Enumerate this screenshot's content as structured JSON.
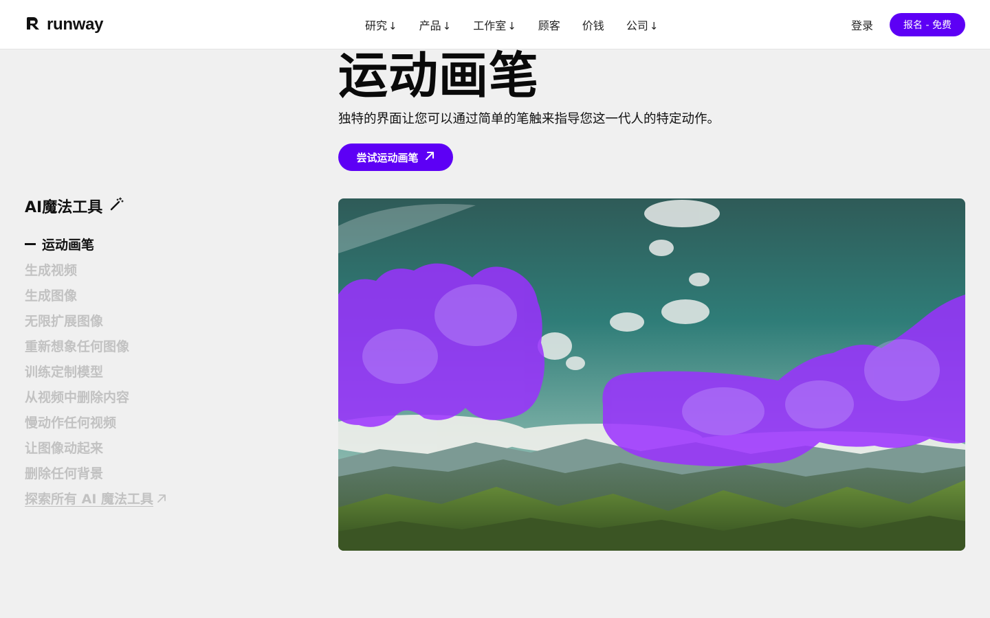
{
  "header": {
    "logo_text": "runway",
    "nav": [
      {
        "label": "研究",
        "arrow": "↓"
      },
      {
        "label": "产品",
        "arrow": "↓"
      },
      {
        "label": "工作室",
        "arrow": "↓"
      },
      {
        "label": "顾客",
        "arrow": ""
      },
      {
        "label": "价钱",
        "arrow": ""
      },
      {
        "label": "公司",
        "arrow": "↓"
      }
    ],
    "login_label": "登录",
    "signup_label": "报名 - 免费"
  },
  "hero": {
    "title": "运动画笔",
    "subtitle": "独特的界面让您可以通过简单的笔触来指导您这一代人的特定动作。",
    "cta_label": "尝试运动画笔"
  },
  "sidebar": {
    "title": "AI魔法工具",
    "items": [
      {
        "label": "运动画笔",
        "active": true
      },
      {
        "label": "生成视频",
        "active": false
      },
      {
        "label": "生成图像",
        "active": false
      },
      {
        "label": "无限扩展图像",
        "active": false
      },
      {
        "label": "重新想象任何图像",
        "active": false
      },
      {
        "label": "训练定制模型",
        "active": false
      },
      {
        "label": "从视频中删除内容",
        "active": false
      },
      {
        "label": "慢动作任何视频",
        "active": false
      },
      {
        "label": "让图像动起来",
        "active": false
      },
      {
        "label": "删除任何背景",
        "active": false
      }
    ],
    "explore_label": "探索所有 AI 魔法工具"
  },
  "colors": {
    "accent": "#5d00f5",
    "brush_overlay": "#9b30ff",
    "background": "#f0f0f0",
    "inactive_text": "#c2c2c2"
  },
  "icons": {
    "logo": "runway-logo-icon",
    "sidebar_title": "magic-wand-icon",
    "cta": "arrow-up-right-icon",
    "explore": "arrow-up-right-icon"
  }
}
